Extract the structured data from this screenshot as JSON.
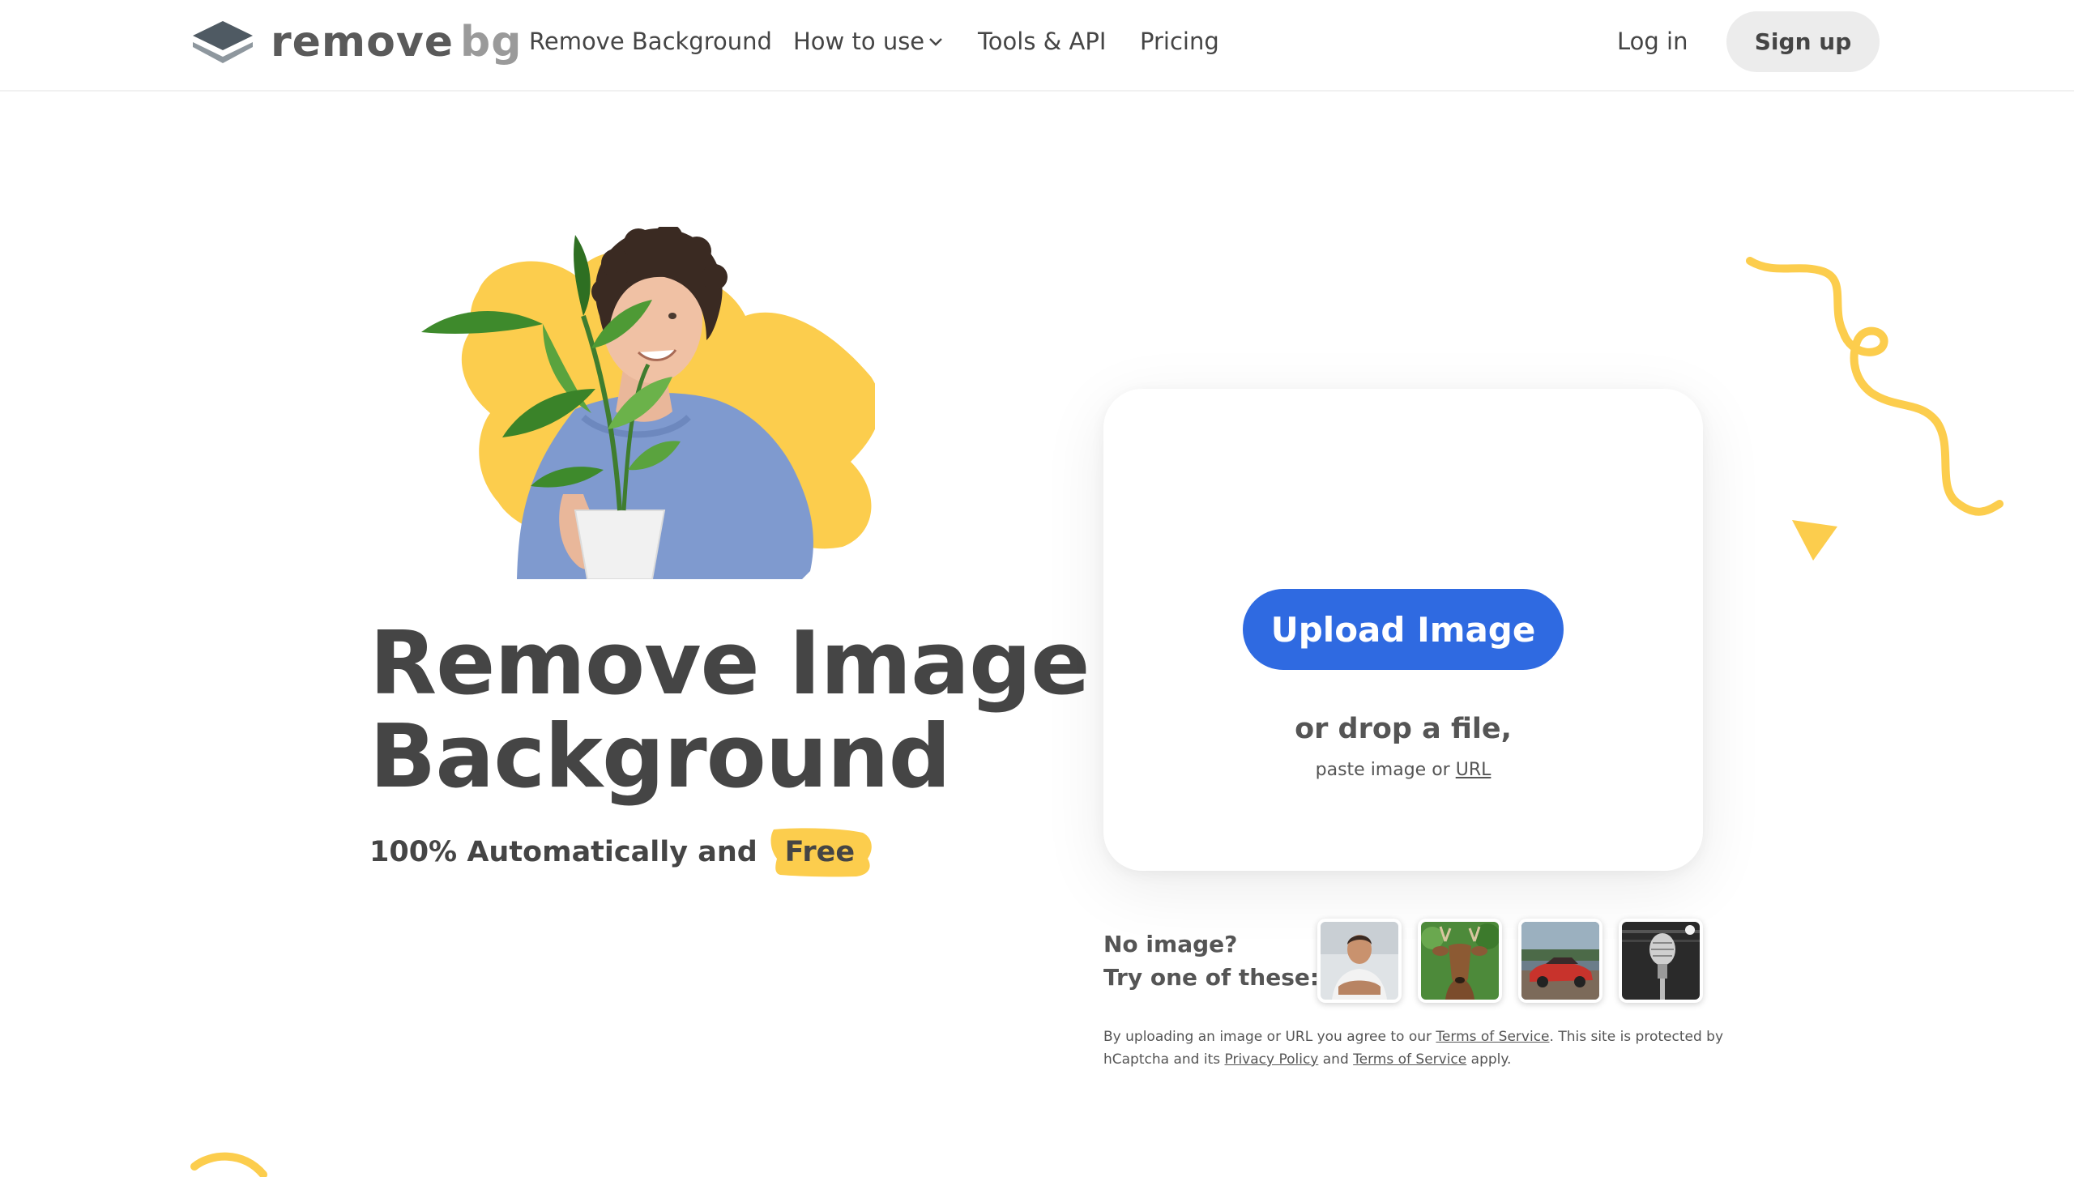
{
  "header": {
    "logo_word_1": "remove",
    "logo_word_2": "bg",
    "nav": [
      {
        "label": "Remove Background"
      },
      {
        "label": "How to use",
        "has_dropdown": true
      },
      {
        "label": "Tools & API"
      },
      {
        "label": "Pricing"
      }
    ],
    "login_label": "Log in",
    "signup_label": "Sign up"
  },
  "hero": {
    "title_line_1": "Remove Image",
    "title_line_2": "Background",
    "subtitle": "100% Automatically and",
    "highlight": "Free"
  },
  "upload": {
    "button_label": "Upload Image",
    "drop_text": "or drop a file,",
    "paste_text": "paste image or",
    "url_link": "URL"
  },
  "samples": {
    "prompt_line_1": "No image?",
    "prompt_line_2": "Try one of these:",
    "items": [
      {
        "icon": "person-photo"
      },
      {
        "icon": "deer-photo"
      },
      {
        "icon": "car-photo"
      },
      {
        "icon": "microphone-photo"
      }
    ]
  },
  "legal": {
    "part_1": "By uploading an image or URL you agree to our",
    "tos_link_1": "Terms of Service",
    "part_2": ". This site is protected by hCaptcha and its",
    "privacy_link": "Privacy Policy",
    "part_3": "and",
    "tos_link_2": "Terms of Service",
    "part_4": "apply."
  },
  "colors": {
    "primary_blue": "#2f6ae1",
    "accent_yellow": "#fccd4d",
    "text_dark": "#454545",
    "signup_bg": "#ececec"
  }
}
